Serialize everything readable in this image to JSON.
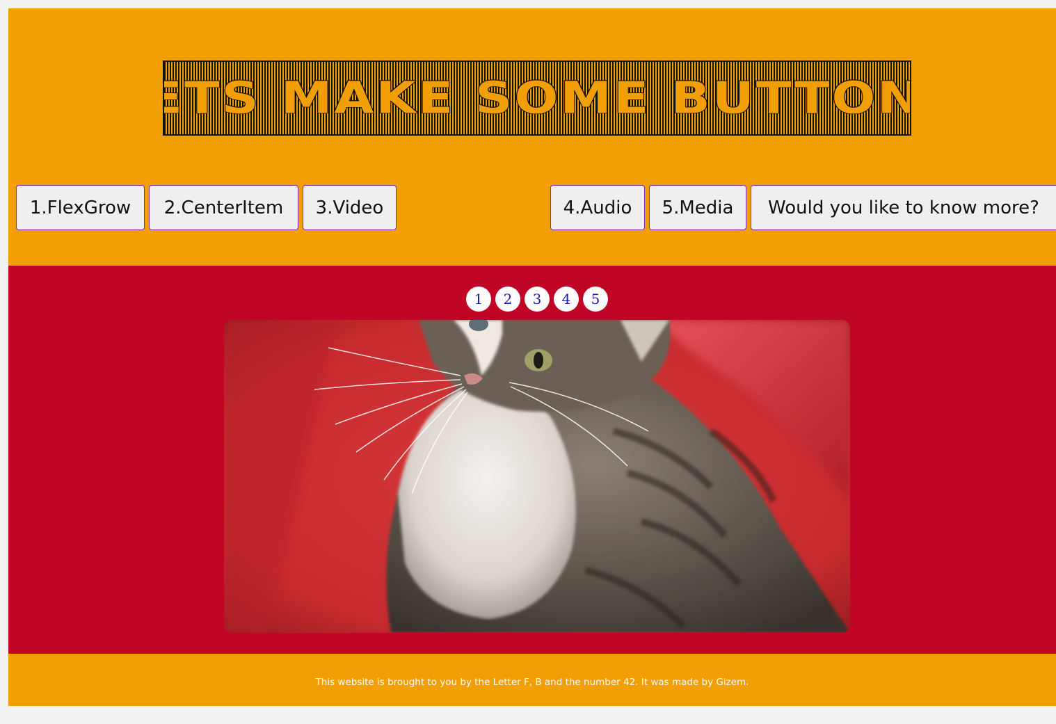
{
  "header": {
    "title": "LETS MAKE SOME BUTTONS",
    "background_color": "#f29e05"
  },
  "nav": {
    "buttons": [
      {
        "label": "1.FlexGrow"
      },
      {
        "label": "2.CenterItem"
      },
      {
        "label": "3.Video"
      },
      {
        "label": "4.Audio"
      },
      {
        "label": "5.Media"
      },
      {
        "label": "Would you like to know more?"
      }
    ],
    "border_color": "#7a2bb5"
  },
  "gallery": {
    "background_color": "#c10526",
    "pages": [
      "1",
      "2",
      "3",
      "4",
      "5"
    ],
    "image": {
      "subject": "tabby kitten on red background",
      "icon": "kitten-photo"
    }
  },
  "footer": {
    "text": "This website is brought to you by the Letter F, B and the number 42. It was made by Gizem."
  }
}
